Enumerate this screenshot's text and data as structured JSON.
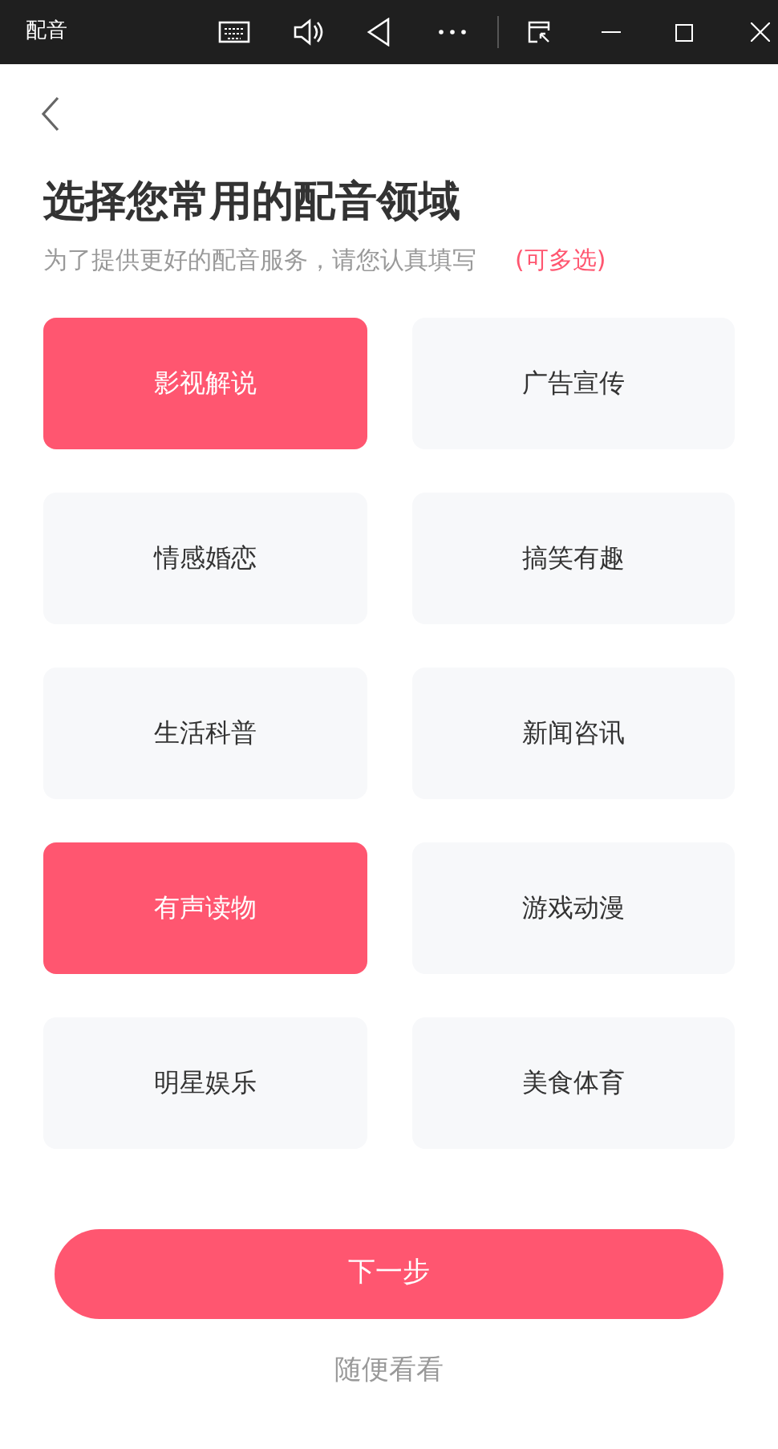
{
  "window": {
    "title": "配音"
  },
  "heading": "选择您常用的配音领域",
  "subtitle": "为了提供更好的配音服务，请您认真填写",
  "hint": "(可多选)",
  "categories": [
    {
      "label": "影视解说",
      "selected": true
    },
    {
      "label": "广告宣传",
      "selected": false
    },
    {
      "label": "情感婚恋",
      "selected": false
    },
    {
      "label": "搞笑有趣",
      "selected": false
    },
    {
      "label": "生活科普",
      "selected": false
    },
    {
      "label": "新闻咨讯",
      "selected": false
    },
    {
      "label": "有声读物",
      "selected": true
    },
    {
      "label": "游戏动漫",
      "selected": false
    },
    {
      "label": "明星娱乐",
      "selected": false
    },
    {
      "label": "美食体育",
      "selected": false
    }
  ],
  "next_button": "下一步",
  "skip_link": "随便看看"
}
